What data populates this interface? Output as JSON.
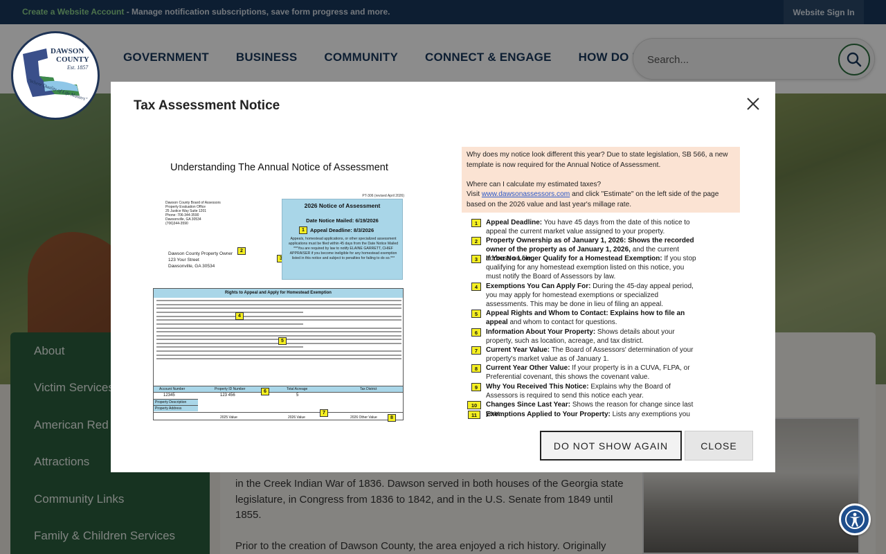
{
  "topbar": {
    "link_text": "Create a Website Account",
    "message": " - Manage notification subscriptions, save form progress and more.",
    "signin_label": "Website Sign In"
  },
  "logo": {
    "name_line1": "DAWSON",
    "name_line2": "COUNTY",
    "est": "Est. 1857",
    "tagline": "\"Where Quality of Life Matters\""
  },
  "nav": {
    "items": [
      "GOVERNMENT",
      "BUSINESS",
      "COMMUNITY",
      "CONNECT & ENGAGE",
      "HOW DO I..."
    ]
  },
  "search": {
    "placeholder": "Search..."
  },
  "sidebar": {
    "items": [
      "About",
      "Victim Services",
      "American Red",
      "Attractions",
      "Community Links",
      "Family & Children Services"
    ]
  },
  "main": {
    "paragraph1": "in the Creek Indian War of 1836. Dawson served in both houses of the Georgia state legislature, in Congress from 1836 to 1842, and in the U.S. Senate from 1849 until 1855.",
    "paragraph2": "Prior to the creation of Dawson County, the area enjoyed a rich history. Originally"
  },
  "modal": {
    "title": "Tax Assessment Notice",
    "btn_do_not_show": "DO NOT SHOW AGAIN",
    "btn_close": "CLOSE"
  },
  "notice": {
    "title": "Understanding The Annual Notice of Assessment",
    "form_id": "PT-306 (revised April 2026)",
    "office_lines": [
      "Dawson County Board of Assessors",
      "Property Evaluation Office",
      "25 Justice Way Suite 1201",
      "Phone: 706-344-3590",
      "Dawsonville, GA 30534",
      "(706)344-3590"
    ],
    "owner_lines": [
      "Dawson County Property Owner",
      "123 Your Street",
      "Dawsonville, GA 30534"
    ],
    "box_heading": "2026 Notice of Assessment",
    "date_mailed": "Date Notice Mailed: 6/19/2026",
    "appeal_deadline": "Appeal Deadline: 8/3/2026",
    "box_text": "Appeals, homestead applications, or other specialized assessment applications must be filed within 45 days from the Date Notice Mailed ***You are required by law to notify ELAINE GARRETT, CHIEF APPRAISER if you become ineligible for any homestead exemption listed in this notice and subject to penalties for failing to do so.***",
    "rights_heading": "Rights to Appeal and Apply for Homestead Exemption",
    "table_headers": [
      "Account Number",
      "Property ID Number",
      "Total Acreage",
      "Tax District"
    ],
    "table_values": [
      "12345",
      "123 456",
      "5",
      ""
    ],
    "table_rows": [
      "Property Description",
      "Property Address"
    ],
    "value_headers": [
      "2025 Value",
      "2026 Value",
      "2026 Other Value"
    ],
    "markers": [
      "1",
      "2",
      "3",
      "4",
      "5",
      "6",
      "7",
      "8"
    ]
  },
  "instructions": {
    "intro1": "Why does my notice look different this year? Due to state legislation, SB 566, a new template is now required for the Annual Notice of Assessment.",
    "intro2": "Where can I calculate my estimated taxes?",
    "intro3_pre": "Visit ",
    "intro3_url": "www.dawsonassessors.com",
    "intro3_post": " and click \"Estimate\" on the left side of the page based on the 2026 value and last year's millage rate.",
    "items": [
      {
        "n": "1",
        "bold": "Appeal Deadline:",
        "text": " You have 45 days from the date of this notice to appeal the current market value assigned to your property."
      },
      {
        "n": "2",
        "bold": "Property Ownership as of January 1, 2026: Shows the recorded owner of the property as of January 1, 2026,",
        "text": " and the current address on file."
      },
      {
        "n": "3",
        "bold": "If You No Longer Qualify for a Homestead Exemption:",
        "text": " If you stop qualifying for any homestead exemption listed on this notice, you must notify the Board of Assessors by law."
      },
      {
        "n": "4",
        "bold": "Exemptions You Can Apply For:",
        "text": " During the 45-day appeal period, you may apply for homestead exemptions or specialized assessments. This may be done in lieu of filing an appeal."
      },
      {
        "n": "5",
        "bold": "Appeal Rights and Whom to Contact: Explains how to file an appeal",
        "text": " and whom to contact for questions."
      },
      {
        "n": "6",
        "bold": "Information About Your Property:",
        "text": " Shows details about your property, such as location, acreage, and tax district."
      },
      {
        "n": "7",
        "bold": "Current Year Value:",
        "text": " The Board of Assessors' determination of your property's market value as of January 1."
      },
      {
        "n": "8",
        "bold": "Current Year Other Value:",
        "text": " If your property is in a CUVA, FLPA, or Preferential covenant, this shows the covenant value."
      },
      {
        "n": "9",
        "bold": "Why You Received This Notice:",
        "text": " Explains why the Board of Assessors is required to send this notice each year."
      },
      {
        "n": "10",
        "bold": "Changes Since Last Year:",
        "text": " Shows the reason for change since last year."
      },
      {
        "n": "11",
        "bold": "Exemptions Applied to Your Property:",
        "text": " Lists any exemptions you"
      }
    ]
  },
  "colors": {
    "topbar": "#19375b",
    "nav_text": "#19375b",
    "sidebar": "#2a5d3c",
    "marker": "#f5ef22",
    "notice_blue": "#a9d6e8",
    "peach": "#fbe3d3"
  }
}
